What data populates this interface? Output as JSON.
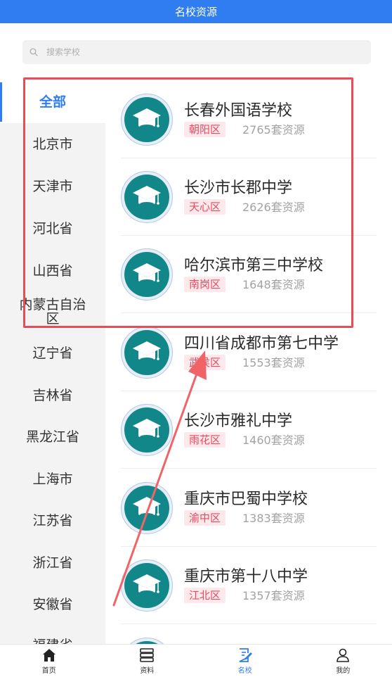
{
  "header": {
    "title": "名校资源"
  },
  "search": {
    "placeholder": "搜索学校"
  },
  "sidebar": {
    "items": [
      {
        "label": "全部",
        "active": true
      },
      {
        "label": "北京市"
      },
      {
        "label": "天津市"
      },
      {
        "label": "河北省"
      },
      {
        "label": "山西省"
      },
      {
        "label": "内蒙古自治区"
      },
      {
        "label": "辽宁省"
      },
      {
        "label": "吉林省"
      },
      {
        "label": "黑龙江省"
      },
      {
        "label": "上海市"
      },
      {
        "label": "江苏省"
      },
      {
        "label": "浙江省"
      },
      {
        "label": "安徽省"
      },
      {
        "label": "福建省"
      }
    ]
  },
  "schools": [
    {
      "name": "长春外国语学校",
      "district": "朝阳区",
      "resources": "2765套资源"
    },
    {
      "name": "长沙市长郡中学",
      "district": "天心区",
      "resources": "2626套资源"
    },
    {
      "name": "哈尔滨市第三中学校",
      "district": "南岗区",
      "resources": "1648套资源"
    },
    {
      "name": "四川省成都市第七中学",
      "district": "武侯区",
      "resources": "1553套资源"
    },
    {
      "name": "长沙市雅礼中学",
      "district": "雨花区",
      "resources": "1460套资源"
    },
    {
      "name": "重庆市巴蜀中学校",
      "district": "渝中区",
      "resources": "1383套资源"
    },
    {
      "name": "重庆市第十八中学",
      "district": "江北区",
      "resources": "1357套资源"
    }
  ],
  "tabbar": {
    "items": [
      {
        "label": "首页",
        "icon": "home-icon"
      },
      {
        "label": "资料",
        "icon": "database-icon"
      },
      {
        "label": "名校",
        "icon": "edit-icon",
        "active": true
      },
      {
        "label": "我的",
        "icon": "user-icon"
      }
    ]
  },
  "colors": {
    "primary": "#2f7df0",
    "tag_bg": "#fde9ec",
    "tag_text": "#e8495f",
    "logo": "#11878a",
    "annotation": "#e84c55"
  }
}
